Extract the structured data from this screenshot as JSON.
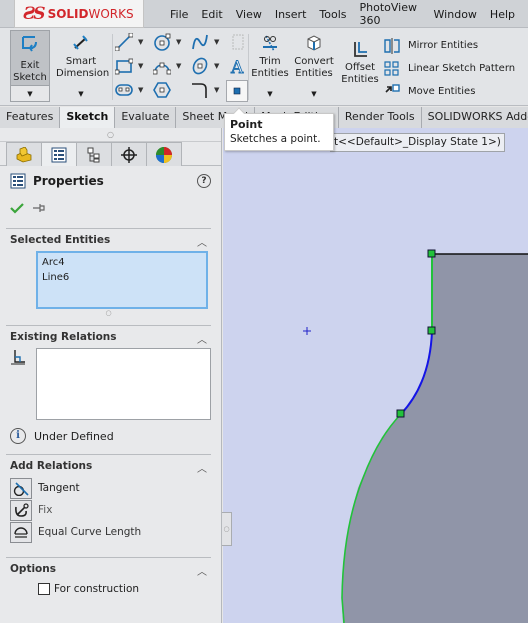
{
  "app": {
    "brand_prefix": "ƧS",
    "brand_bold": "SOLID",
    "brand_light": "WORKS"
  },
  "menu": [
    "File",
    "Edit",
    "View",
    "Insert",
    "Tools",
    "PhotoView 360",
    "Window",
    "Help"
  ],
  "ribbon": {
    "exit_sketch": "Exit Sketch",
    "smart_dimension": "Smart Dimension",
    "trim_entities": "Trim Entities",
    "convert_entities": "Convert Entities",
    "offset_entities": "Offset Entities",
    "mirror_entities": "Mirror Entities",
    "linear_sketch_pattern": "Linear Sketch Pattern",
    "move_entities": "Move Entities",
    "small_tools": [
      "line",
      "circle",
      "spline",
      "plane",
      "rectangle",
      "arc",
      "ellipse",
      "text",
      "slot",
      "polygon",
      "fillet",
      "point"
    ]
  },
  "tabs": [
    {
      "label": "Features",
      "active": false
    },
    {
      "label": "Sketch",
      "active": true
    },
    {
      "label": "Evaluate",
      "active": false
    },
    {
      "label": "Sheet Metal",
      "active": false
    },
    {
      "label": "Mesh Editing",
      "active": false
    },
    {
      "label": "Render Tools",
      "active": false
    },
    {
      "label": "SOLIDWORKS Add-Ins",
      "active": false
    }
  ],
  "tooltip": {
    "title": "Point",
    "description": "Sketches a point."
  },
  "graphics": {
    "model_title": "t<<Default>_Display State 1>)",
    "colors": {
      "background": "#cdd3ee",
      "body": "#9095a8",
      "selected_green": "#22c23a",
      "arc_blue": "#1414e6"
    }
  },
  "panel": {
    "tabs": [
      "feature-manager",
      "property-manager",
      "configuration-manager",
      "dimxpert-manager",
      "display-manager"
    ],
    "title": "Properties",
    "help": "?",
    "selected_entities": {
      "header": "Selected Entities",
      "items": [
        "Arc4",
        "Line6"
      ]
    },
    "existing_relations": {
      "header": "Existing Relations",
      "status": "Under Defined"
    },
    "add_relations": {
      "header": "Add Relations",
      "items": [
        {
          "label": "Tangent",
          "icon": "tangent-icon",
          "enabled": true
        },
        {
          "label": "Fix",
          "icon": "fix-icon",
          "enabled": false
        },
        {
          "label": "Equal Curve Length",
          "icon": "equal-curve-length-icon",
          "enabled": false
        }
      ]
    },
    "options": {
      "header": "Options",
      "for_construction": "For construction",
      "for_construction_checked": false
    }
  }
}
